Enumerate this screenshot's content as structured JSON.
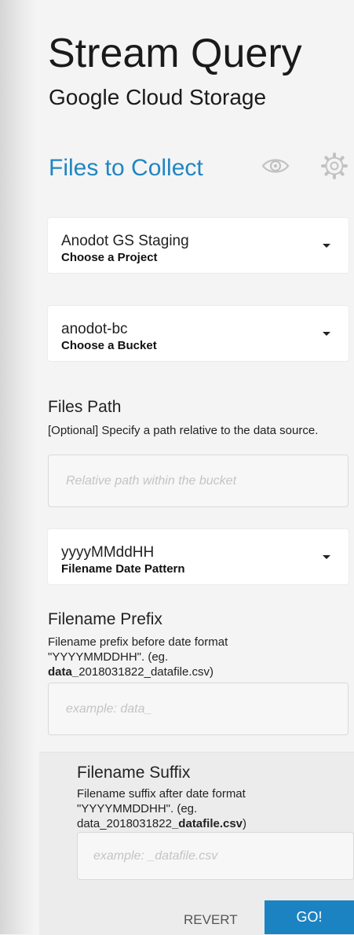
{
  "header": {
    "title": "Stream Query",
    "subtitle": "Google Cloud Storage"
  },
  "section": {
    "title": "Files to Collect",
    "icons": [
      "eye-icon",
      "gear-icon"
    ]
  },
  "project": {
    "value": "Anodot GS Staging",
    "label": "Choose a Project"
  },
  "bucket": {
    "value": "anodot-bc",
    "label": "Choose a Bucket"
  },
  "files_path": {
    "title": "Files Path",
    "description": "[Optional] Specify a path relative to the data source.",
    "placeholder": "Relative path within the bucket",
    "value": ""
  },
  "date_pattern": {
    "value": "yyyyMMddHH",
    "label": "Filename Date Pattern"
  },
  "prefix": {
    "title": "Filename Prefix",
    "description_lead": "Filename prefix before date format \"YYYYMMDDHH\". (eg.",
    "example_bold": "data_",
    "example_rest": "2018031822_datafile.csv)",
    "placeholder": "example: data_",
    "value": ""
  },
  "suffix": {
    "title": "Filename Suffix",
    "description_lead": "Filename suffix after date format \"YYYYMMDDHH\". (eg.",
    "example_start": "data_2018031822",
    "example_bold": "_datafile.csv",
    "example_end": ")",
    "placeholder": "example: _datafile.csv",
    "value": ""
  },
  "actions": {
    "revert_label": "REVERT",
    "go_label": "GO!"
  },
  "colors": {
    "accent": "#1f86c2",
    "go_button": "#1c83c2"
  }
}
